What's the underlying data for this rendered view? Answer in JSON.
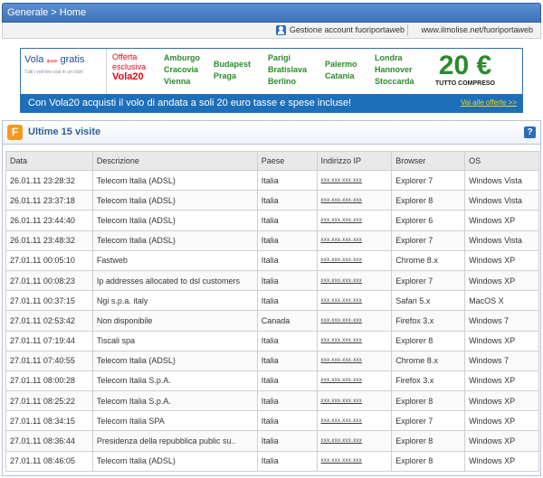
{
  "breadcrumb": "Generale > Home",
  "account": {
    "label": "Gestione account fuoriportaweb",
    "site": "www.ilmolise.net/fuoriportaweb"
  },
  "banner": {
    "brand_left": "Vola",
    "brand_small": "quasi",
    "brand_right": "gratis",
    "tagline": "Tutti i voli low cost in un click!",
    "offer_line1": "Offerta",
    "offer_line2": "esclusiva",
    "offer_code": "Vola20",
    "cities_col1": [
      "Amburgo",
      "Cracovia",
      "Vienna"
    ],
    "cities_col2": [
      "Budapest",
      "Praga"
    ],
    "cities_col3": [
      "Parigi",
      "Bratislava",
      "Berlino"
    ],
    "cities_col4": [
      "Palermo",
      "Catania"
    ],
    "cities_col5": [
      "Londra",
      "Hannover",
      "Stoccarda"
    ],
    "price": "20 €",
    "price_sub": "TUTTO COMPRESO",
    "strip_text": "Con Vola20 acquisti il volo di andata a soli 20 euro tasse e spese incluse!",
    "cta": "Vai alle offerte >>"
  },
  "panel": {
    "icon_letter": "F",
    "title": "Ultime 15 visite",
    "help": "?"
  },
  "table": {
    "headers": [
      "Data",
      "Descrizione",
      "Paese",
      "Indirizzo IP",
      "Browser",
      "OS"
    ],
    "rows": [
      [
        "26.01.11  23:28:32",
        "Telecom Italia (ADSL)",
        "Italia",
        "xxx.xxx.xxx.xxx",
        "Explorer 7",
        "Windows Vista"
      ],
      [
        "26.01.11  23:37:18",
        "Telecom Italia (ADSL)",
        "Italia",
        "xxx.xxx.xxx.xxx",
        "Explorer 8",
        "Windows Vista"
      ],
      [
        "26.01.11  23:44:40",
        "Telecom Italia (ADSL)",
        "Italia",
        "xxx.xxx.xxx.xxx",
        "Explorer 6",
        "Windows XP"
      ],
      [
        "26.01.11  23:48:32",
        "Telecom Italia (ADSL)",
        "Italia",
        "xxx.xxx.xxx.xxx",
        "Explorer 7",
        "Windows Vista"
      ],
      [
        "27.01.11  00:05:10",
        "Fastweb",
        "Italia",
        "xxx.xxx.xxx.xxx",
        "Chrome 8.x",
        "Windows XP"
      ],
      [
        "27.01.11  00:08:23",
        "Ip addresses allocated to dsl customers",
        "Italia",
        "xxx.xxx.xxx.xxx",
        "Explorer 7",
        "Windows XP"
      ],
      [
        "27.01.11  00:37:15",
        "Ngi s.p.a. italy",
        "Italia",
        "xxx.xxx.xxx.xxx",
        "Safari 5.x",
        "MacOS X"
      ],
      [
        "27.01.11  02:53:42",
        "Non disponibile",
        "Canada",
        "xxx.xxx.xxx.xxx",
        "Firefox 3.x",
        "Windows 7"
      ],
      [
        "27.01.11  07:19:44",
        "Tiscali spa",
        "Italia",
        "xxx.xxx.xxx.xxx",
        "Explorer 8",
        "Windows XP"
      ],
      [
        "27.01.11  07:40:55",
        "Telecom Italia (ADSL)",
        "Italia",
        "xxx.xxx.xxx.xxx",
        "Chrome 8.x",
        "Windows 7"
      ],
      [
        "27.01.11  08:00:28",
        "Telecom Italia S.p.A.",
        "Italia",
        "xxx.xxx.xxx.xxx",
        "Firefox 3.x",
        "Windows XP"
      ],
      [
        "27.01.11  08:25:22",
        "Telecom Italia S.p.A.",
        "Italia",
        "xxx.xxx.xxx.xxx",
        "Explorer 8",
        "Windows XP"
      ],
      [
        "27.01.11  08:34:15",
        "Telecom Italia SPA",
        "Italia",
        "xxx.xxx.xxx.xxx",
        "Explorer 7",
        "Windows XP"
      ],
      [
        "27.01.11  08:36:44",
        "Presidenza della repubblica public su..",
        "Italia",
        "xxx.xxx.xxx.xxx",
        "Explorer 8",
        "Windows XP"
      ],
      [
        "27.01.11  08:46:05",
        "Telecom Italia (ADSL)",
        "Italia",
        "xxx.xxx.xxx.xxx",
        "Explorer 8",
        "Windows XP"
      ]
    ]
  }
}
